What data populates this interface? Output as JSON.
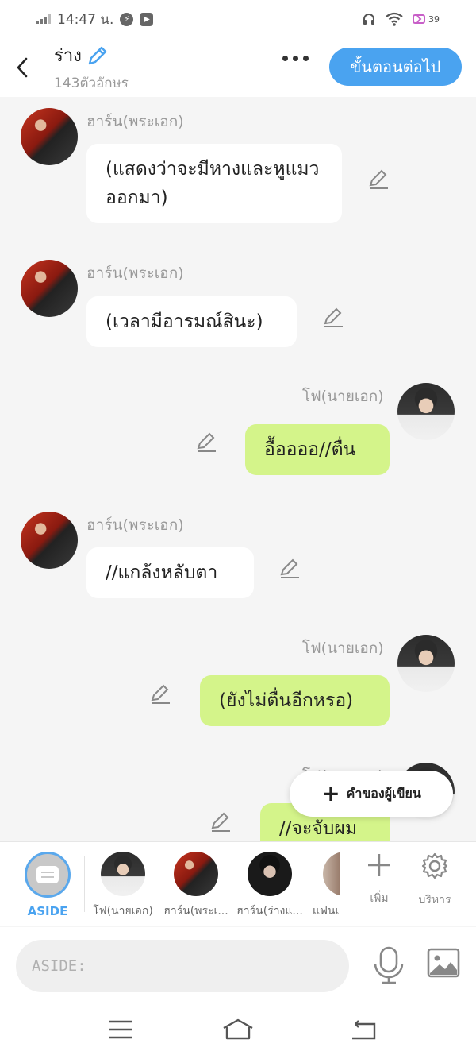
{
  "status": {
    "time": "14:47 น.",
    "battery": "39"
  },
  "header": {
    "title": "ร่าง",
    "char_count": "143ตัวอักษร",
    "next_label": "ขั้นตอนต่อไป"
  },
  "messages": [
    {
      "side": "left",
      "sender": "ฮาร์น(พระเอก)",
      "text": "(แสดงว่าจะมีหางและหูแมวออกมา)"
    },
    {
      "side": "left",
      "sender": "ฮาร์น(พระเอก)",
      "text": "(เวลามีอารมณ์สินะ)"
    },
    {
      "side": "right",
      "sender": "โฟ(นายเอก)",
      "text": "อื้ออออ//ตื่น"
    },
    {
      "side": "left",
      "sender": "ฮาร์น(พระเอก)",
      "text": "//แกล้งหลับตา"
    },
    {
      "side": "right",
      "sender": "โฟ(นายเอก)",
      "text": "(ยังไม่ตื่นอีกหรอ)"
    },
    {
      "side": "right",
      "sender": "โฟ(นายเอก)",
      "text": "//จะจับผม"
    }
  ],
  "author_note_label": "คำของผู้เขียน",
  "characters": {
    "aside_label": "ASIDE",
    "items": [
      {
        "label": "โฟ(นายเอก)"
      },
      {
        "label": "ฮาร์น(พระเ..."
      },
      {
        "label": "ฮาร์น(ร่างแ..."
      },
      {
        "label": "แฟนเ"
      }
    ],
    "add_label": "เพิ่ม",
    "manage_label": "บริหาร"
  },
  "input": {
    "placeholder": "ASIDE:"
  }
}
